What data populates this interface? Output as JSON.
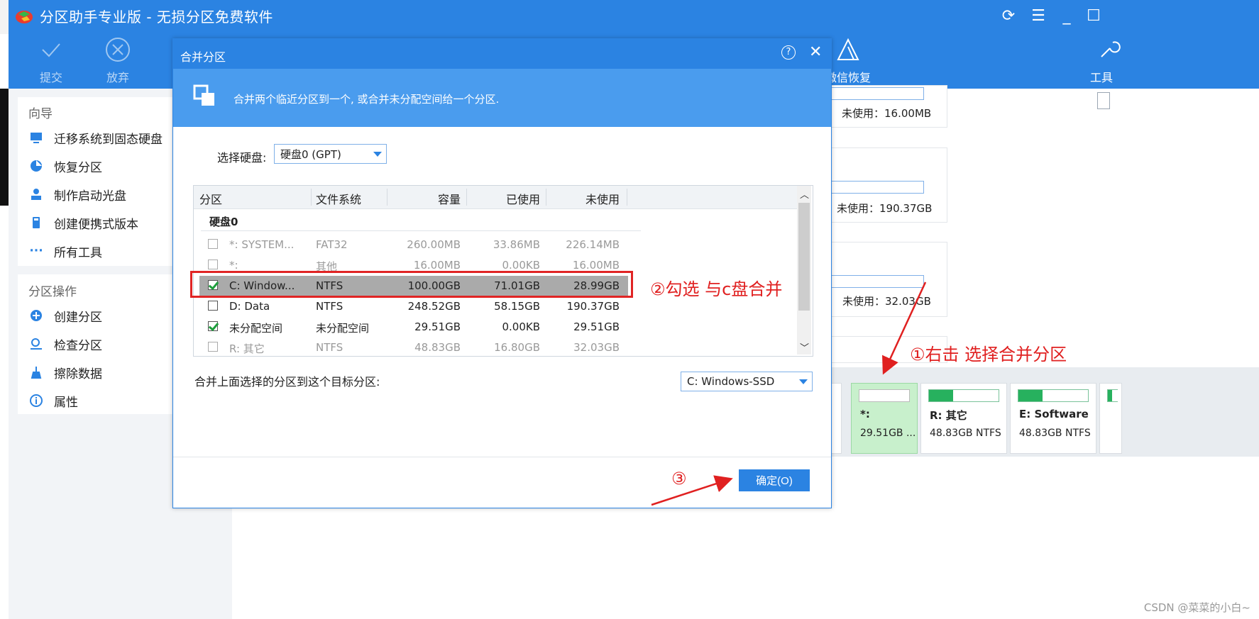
{
  "app": {
    "title": "分区助手专业版 - 无损分区免费软件",
    "window_buttons": [
      "refresh-icon",
      "menu-icon",
      "minimize-icon",
      "maximize-icon"
    ]
  },
  "toolbar": {
    "submit": "提交",
    "discard": "放弃",
    "wechat_recovery": "微信恢复",
    "tools": "工具"
  },
  "sidebar": {
    "wizard_title": "向导",
    "wizard_items": [
      "迁移系统到固态硬盘",
      "恢复分区",
      "制作启动光盘",
      "创建便携式版本",
      "所有工具"
    ],
    "ops_title": "分区操作",
    "ops_items": [
      "创建分区",
      "检查分区",
      "擦除数据",
      "属性"
    ]
  },
  "right_panel": {
    "unused": [
      "未使用：16.00MB",
      "未使用：190.37GB",
      "未使用：32.03GB"
    ],
    "partitions": [
      {
        "name": "*:",
        "size": "29.51GB ...",
        "fill": 0.0
      },
      {
        "name": "R: 其它",
        "size": "48.83GB NTFS",
        "fill": 0.35
      },
      {
        "name": "E: Software",
        "size": "48.83GB NTFS",
        "fill": 0.35
      }
    ]
  },
  "dialog": {
    "title": "合并分区",
    "banner_text": "合并两个临近分区到一个, 或合并未分配空间给一个分区.",
    "select_disk_label": "选择硬盘:",
    "select_disk_value": "硬盘0 (GPT)",
    "columns": [
      "分区",
      "文件系统",
      "容量",
      "已使用",
      "未使用"
    ],
    "group": "硬盘0",
    "rows": [
      {
        "name": "*: SYSTEM...",
        "fs": "FAT32",
        "cap": "260.00MB",
        "used": "33.86MB",
        "free": "226.14MB",
        "checked": false,
        "dim": true
      },
      {
        "name": "*:",
        "fs": "其他",
        "cap": "16.00MB",
        "used": "0.00KB",
        "free": "16.00MB",
        "checked": false,
        "dim": true
      },
      {
        "name": "C: Window...",
        "fs": "NTFS",
        "cap": "100.00GB",
        "used": "71.01GB",
        "free": "28.99GB",
        "checked": true,
        "dim": false,
        "selected": true
      },
      {
        "name": "D: Data",
        "fs": "NTFS",
        "cap": "248.52GB",
        "used": "58.15GB",
        "free": "190.37GB",
        "checked": false,
        "dim": false
      },
      {
        "name": "未分配空间",
        "fs": "未分配空间",
        "cap": "29.51GB",
        "used": "0.00KB",
        "free": "29.51GB",
        "checked": true,
        "dim": false
      },
      {
        "name": "R: 其它",
        "fs": "NTFS",
        "cap": "48.83GB",
        "used": "16.80GB",
        "free": "32.03GB",
        "checked": false,
        "dim": true
      }
    ],
    "target_label": "合并上面选择的分区到这个目标分区:",
    "target_value": "C: Windows-SSD",
    "ok_button": "确定(O)"
  },
  "annotations": {
    "step1": "①右击 选择合并分区",
    "step2": "②勾选 与c盘合并",
    "step3": "③"
  },
  "watermark": "CSDN @菜菜的小白~",
  "colors": {
    "accent": "#2b83e2",
    "annotation": "#e02020",
    "check": "#1e9e3c"
  }
}
